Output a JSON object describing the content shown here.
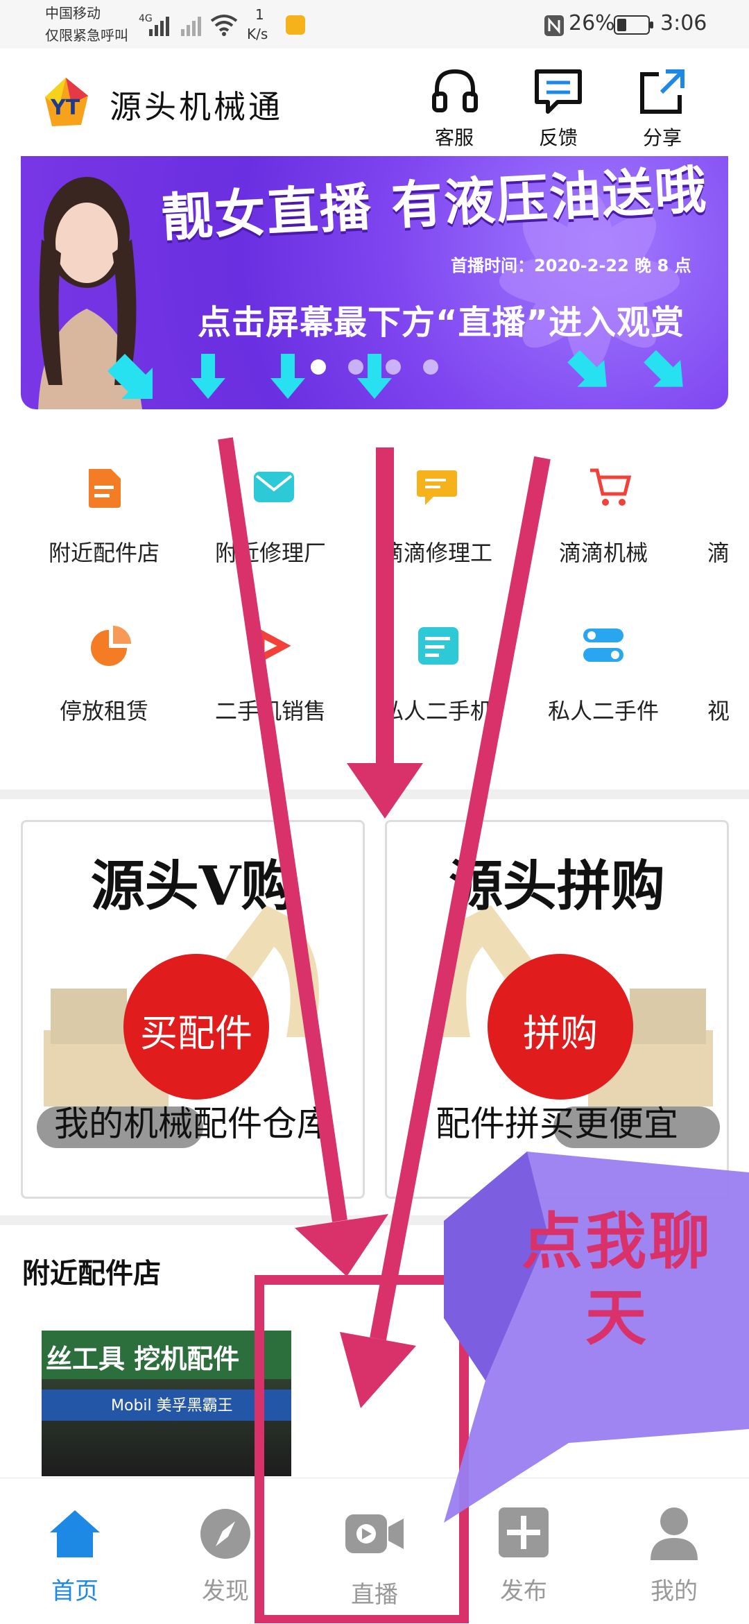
{
  "status_bar": {
    "carrier": "中国移动",
    "emergency": "仅限紧急呼叫",
    "network": "4G",
    "speed_value": "1",
    "speed_unit": "K/s",
    "battery": "26%",
    "time": "3:06"
  },
  "header": {
    "title": "源头机械通",
    "buttons": [
      {
        "label": "客服",
        "icon": "headset-icon"
      },
      {
        "label": "反馈",
        "icon": "feedback-icon"
      },
      {
        "label": "分享",
        "icon": "share-icon"
      }
    ]
  },
  "banner": {
    "headline": "靓女直播 有液压油送哦",
    "time_label": "首播时间：2020-2-22 晚 8 点",
    "subline": "点击屏幕最下方“直播”进入观赏",
    "slide_count": 4,
    "active_slide": 1
  },
  "quick_menu": [
    {
      "label": "附近配件店",
      "icon": "document-icon",
      "color": "#f47c25"
    },
    {
      "label": "附近修理厂",
      "icon": "mail-icon",
      "color": "#2ec9d6"
    },
    {
      "label": "滴滴修理工",
      "icon": "chat-bubble-icon",
      "color": "#f6b21b"
    },
    {
      "label": "滴滴机械",
      "icon": "cart-icon",
      "color": "#f2413a"
    },
    {
      "label": "滴",
      "icon": "",
      "color": ""
    },
    {
      "label": "停放租赁",
      "icon": "pie-chart-icon",
      "color": "#f47c25"
    },
    {
      "label": "二手机销售",
      "icon": "play-icon",
      "color": "#f2413a"
    },
    {
      "label": "私人二手机",
      "icon": "list-icon",
      "color": "#2ec9d6"
    },
    {
      "label": "私人二手件",
      "icon": "toggle-icon",
      "color": "#29a6f0"
    },
    {
      "label": "视",
      "icon": "",
      "color": ""
    }
  ],
  "promos": [
    {
      "title": "源头V购",
      "badge": "买配件",
      "subtitle": "我的机械配件仓库"
    },
    {
      "title": "源头拼购",
      "badge": "拼购",
      "subtitle": "配件拼买更便宜"
    }
  ],
  "nearby": {
    "title": "附近配件店",
    "shop_sign_1": "丝工具 挖机配件",
    "shop_sign_2": "Mobil 美孚黑霸王"
  },
  "chat_bubble": {
    "line1": "点我聊",
    "line2": "天"
  },
  "bottom_nav": [
    {
      "label": "首页",
      "icon": "home-icon",
      "active": true
    },
    {
      "label": "发现",
      "icon": "compass-icon",
      "active": false
    },
    {
      "label": "直播",
      "icon": "video-camera-icon",
      "active": false
    },
    {
      "label": "发布",
      "icon": "plus-icon",
      "active": false
    },
    {
      "label": "我的",
      "icon": "user-icon",
      "active": false
    }
  ],
  "colors": {
    "accent_blue": "#1e88e5",
    "annotation_pink": "#d9326b",
    "banner_purple": "#7f45f0",
    "chat_purple": "#9a7ef0",
    "promo_red": "#e01c1c"
  }
}
